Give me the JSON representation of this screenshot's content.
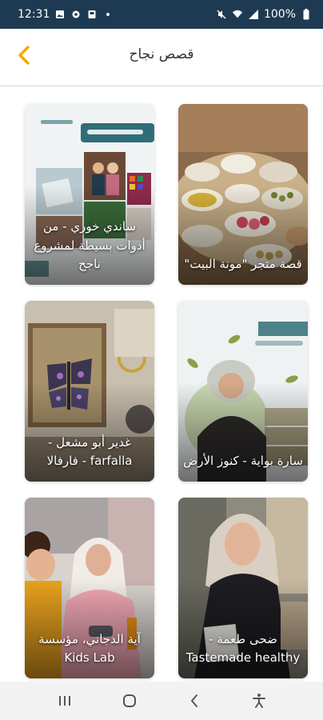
{
  "status_bar": {
    "time": "12:31",
    "battery": "100%",
    "left_icons": [
      "photo-icon",
      "settings-icon",
      "notification-icon",
      "dot-icon"
    ],
    "right_icons": [
      "mute-icon",
      "wifi-icon",
      "signal-icon",
      "battery-icon"
    ]
  },
  "header": {
    "title": "قصص نجاح",
    "back_icon": "chevron-left-icon",
    "accent_color": "#f2a900"
  },
  "cards": [
    {
      "title": "قصة متجر \"مونة البيت\"",
      "theme": "food-table"
    },
    {
      "title": "ساندي خوري - من أدوات بسيطة لمشروع ناجح",
      "theme": "poster-light"
    },
    {
      "title": "سارة بواية - كنوز الأرض",
      "theme": "portrait-olive"
    },
    {
      "title": "غدير أبو مشعل - farfalla - فارفالا",
      "theme": "butterfly-frame"
    },
    {
      "title": "ضحى طعمة - Tastemade healthy",
      "theme": "portrait-hijab"
    },
    {
      "title": "آية الدجاني، مؤسسة Kids Lab",
      "theme": "kids-lab"
    }
  ],
  "nav_bar": {
    "recent_icon": "recent-apps-icon",
    "home_icon": "home-icon",
    "back_icon": "back-icon",
    "accessibility_icon": "accessibility-icon"
  }
}
